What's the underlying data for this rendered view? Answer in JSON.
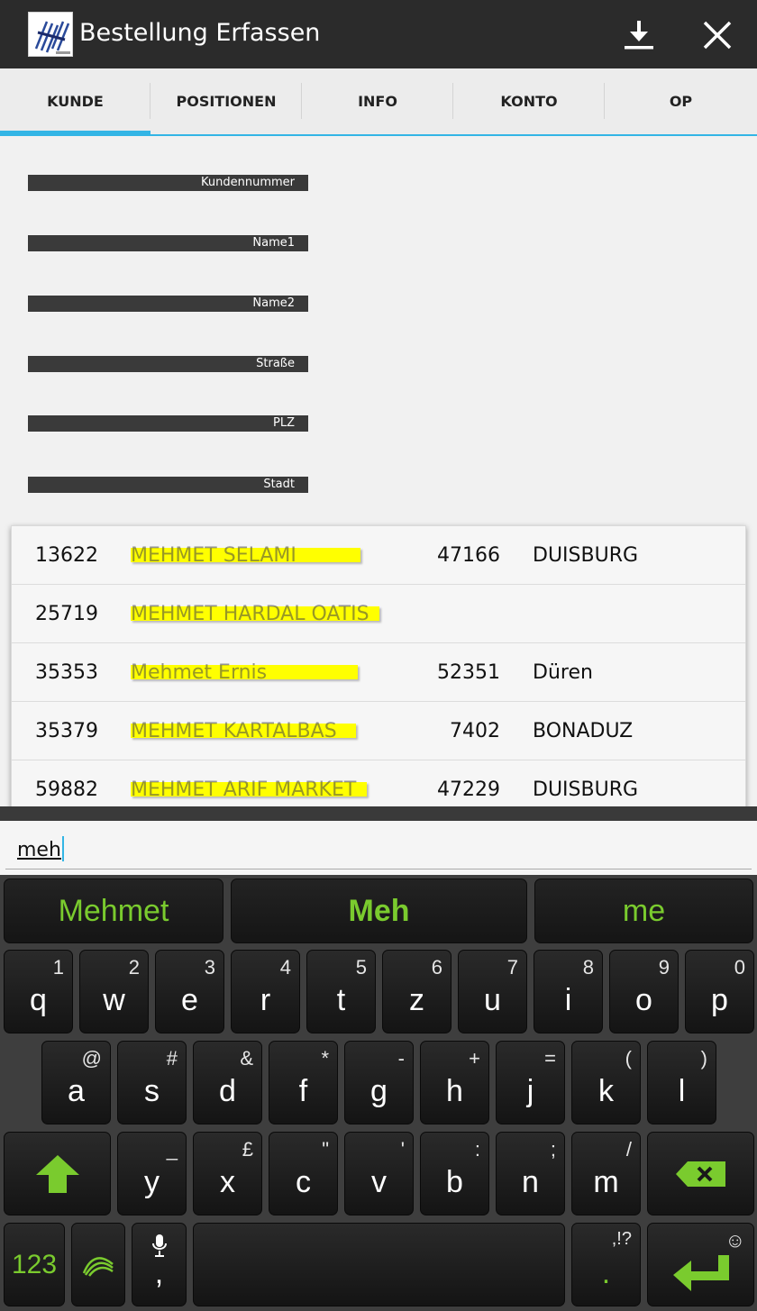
{
  "app": {
    "title": "Bestellung Erfassen",
    "logo_icon": "company-logo-icon",
    "actions": [
      {
        "name": "download-icon"
      },
      {
        "name": "close-icon"
      }
    ]
  },
  "tabs": [
    {
      "label": "KUNDE",
      "active": true
    },
    {
      "label": "POSITIONEN",
      "active": false
    },
    {
      "label": "INFO",
      "active": false
    },
    {
      "label": "KONTO",
      "active": false
    },
    {
      "label": "OP",
      "active": false
    }
  ],
  "fields": [
    {
      "label": "Kundennummer"
    },
    {
      "label": "Name1"
    },
    {
      "label": "Name2"
    },
    {
      "label": "Straße"
    },
    {
      "label": "PLZ"
    },
    {
      "label": "Stadt"
    }
  ],
  "suggestions": [
    {
      "id": "13622",
      "name": "MEHMET SELAMI",
      "zip": "47166",
      "city": "DUISBURG"
    },
    {
      "id": "25719",
      "name": "MEHMET HARDAL OATIS",
      "zip": "",
      "city": ""
    },
    {
      "id": "35353",
      "name": "Mehmet Ernis",
      "zip": "52351",
      "city": "Düren"
    },
    {
      "id": "35379",
      "name": "MEHMET KARTALBAS",
      "zip": "7402",
      "city": "BONADUZ"
    },
    {
      "id": "59882",
      "name": "MEHMET ARIF MARKET",
      "zip": "47229",
      "city": "DUISBURG"
    }
  ],
  "search": {
    "value": "meh"
  },
  "keyboard": {
    "suggestions": [
      "Mehmet",
      "Meh",
      "me"
    ],
    "row1": [
      {
        "key": "q",
        "sec": "1"
      },
      {
        "key": "w",
        "sec": "2"
      },
      {
        "key": "e",
        "sec": "3"
      },
      {
        "key": "r",
        "sec": "4"
      },
      {
        "key": "t",
        "sec": "5"
      },
      {
        "key": "z",
        "sec": "6"
      },
      {
        "key": "u",
        "sec": "7"
      },
      {
        "key": "i",
        "sec": "8"
      },
      {
        "key": "o",
        "sec": "9"
      },
      {
        "key": "p",
        "sec": "0"
      }
    ],
    "row2": [
      {
        "key": "a",
        "sec": "@"
      },
      {
        "key": "s",
        "sec": "#"
      },
      {
        "key": "d",
        "sec": "&"
      },
      {
        "key": "f",
        "sec": "*"
      },
      {
        "key": "g",
        "sec": "-"
      },
      {
        "key": "h",
        "sec": "+"
      },
      {
        "key": "j",
        "sec": "="
      },
      {
        "key": "k",
        "sec": "("
      },
      {
        "key": "l",
        "sec": ")"
      }
    ],
    "row3": [
      {
        "key": "y",
        "sec": "_"
      },
      {
        "key": "x",
        "sec": "£"
      },
      {
        "key": "c",
        "sec": "\""
      },
      {
        "key": "v",
        "sec": "'"
      },
      {
        "key": "b",
        "sec": ":"
      },
      {
        "key": "n",
        "sec": ";"
      },
      {
        "key": "m",
        "sec": "/"
      }
    ],
    "numbers_label": "123",
    "comma_label": ",",
    "period_label": ".",
    "period_sec": ",!?",
    "accent_color": "#7acb2e"
  }
}
